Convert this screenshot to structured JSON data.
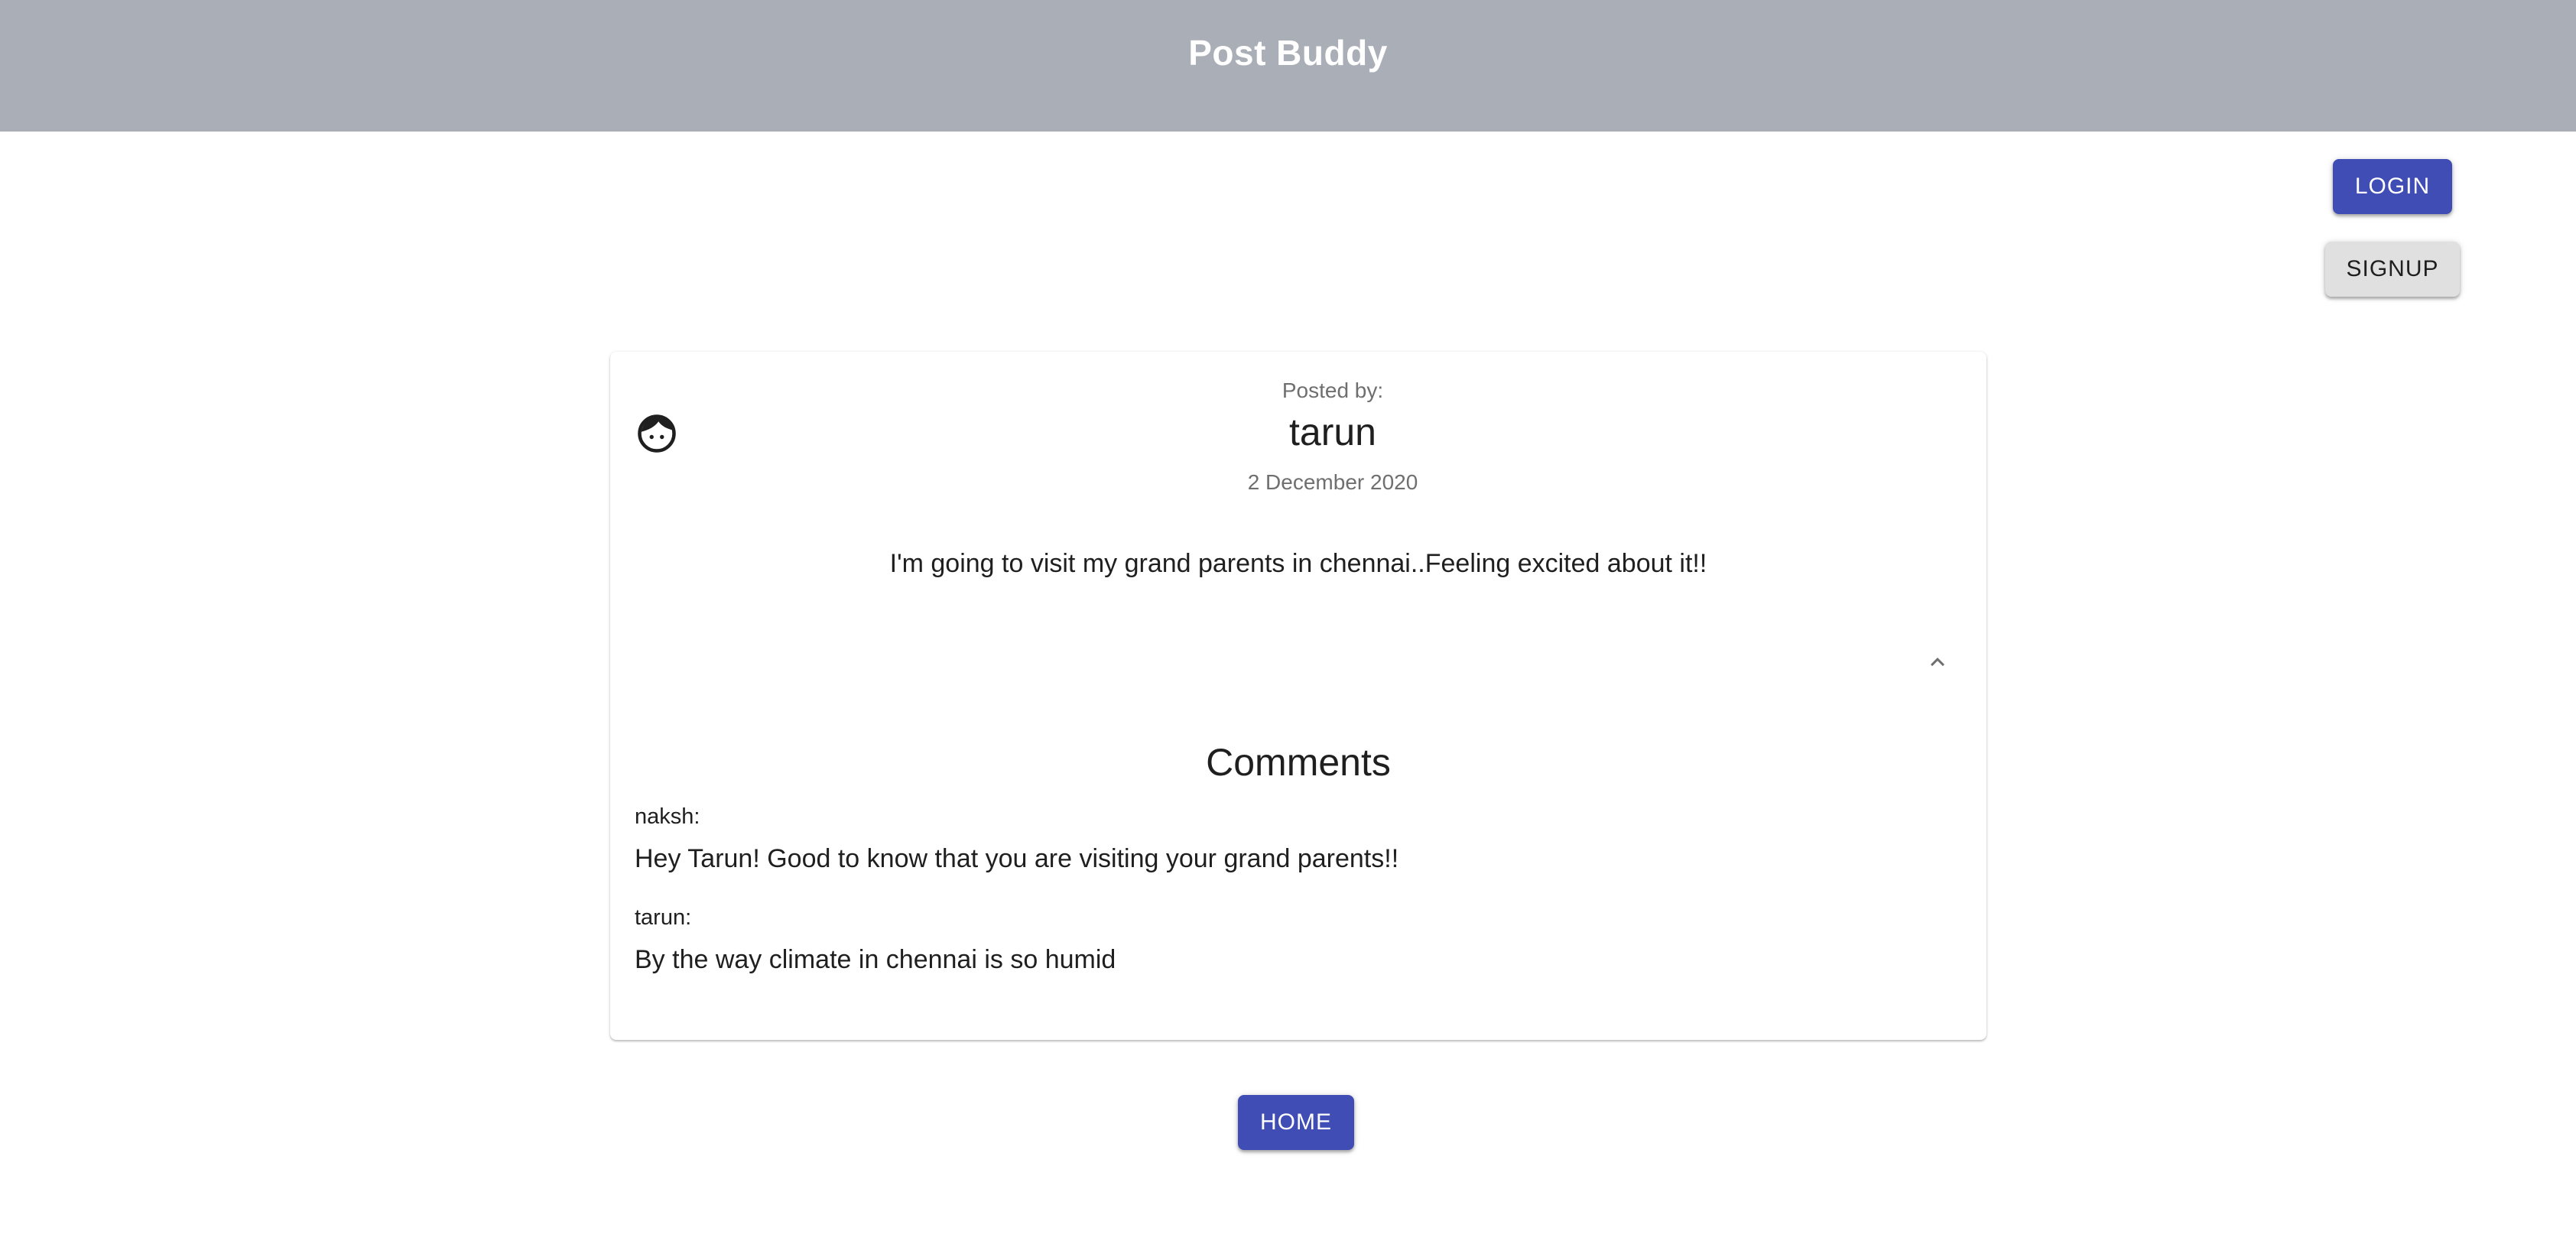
{
  "header": {
    "title": "Post Buddy"
  },
  "auth": {
    "login_label": "LOGIN",
    "signup_label": "SIGNUP"
  },
  "post": {
    "posted_by_label": "Posted by:",
    "author": "tarun",
    "date": "2 December 2020",
    "content": "I'm going to visit my grand parents in chennai..Feeling excited about it!!",
    "avatar_icon": "face-icon",
    "collapse_icon": "chevron-up-icon"
  },
  "comments": {
    "title": "Comments",
    "items": [
      {
        "author": "naksh:",
        "text": "Hey Tarun! Good to know that you are visiting your grand parents!!"
      },
      {
        "author": "tarun:",
        "text": "By the way climate in chennai is so humid"
      }
    ]
  },
  "footer": {
    "home_label": "HOME"
  },
  "colors": {
    "header_bg": "#aaaeb6",
    "primary": "#3f4db5",
    "secondary_button": "#e0e0e0"
  }
}
